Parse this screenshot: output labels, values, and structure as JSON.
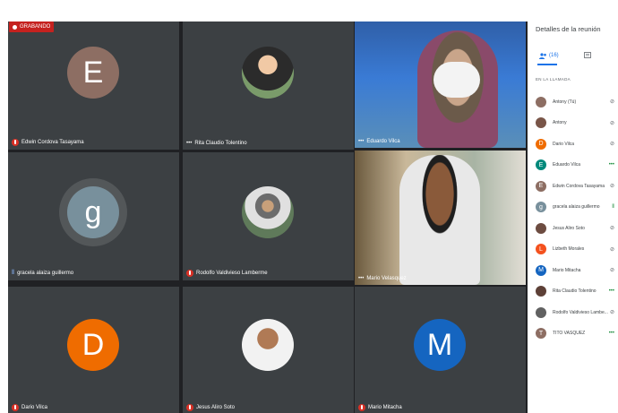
{
  "recording": {
    "label": "GRABANDO"
  },
  "tiles": [
    {
      "name": "Edwin Cordova Tasayama",
      "initial": "E",
      "color": "#8d6e63",
      "mic": "off"
    },
    {
      "name": "Rita Claudio Tolentino",
      "mic": "dots"
    },
    {
      "name": "Eduardo Vilca",
      "mic": "dots"
    },
    {
      "name": "gracela alaiza guillermo",
      "initial": "g",
      "color": "#78909c",
      "mic": "on"
    },
    {
      "name": "Rodolfo Valdivieso Lamberme",
      "mic": "off"
    },
    {
      "name": "Mario Velasquez",
      "mic": "dots"
    },
    {
      "name": "Dario Vilca",
      "initial": "D",
      "color": "#ef6c00",
      "mic": "off"
    },
    {
      "name": "Jesus Aliro Soto",
      "mic": "off"
    },
    {
      "name": "Mario Mitacha",
      "initial": "M",
      "color": "#1565c0",
      "mic": "off"
    }
  ],
  "panel": {
    "title": "Detalles de la reunión",
    "tab_people_label": "(16)",
    "section_label": "EN LA LLAMADA",
    "participants": [
      {
        "name": "Antony (Tú)",
        "initial": "",
        "color": "#8d6e63",
        "mic": "off"
      },
      {
        "name": "Antony",
        "initial": "",
        "color": "#795548",
        "mic": "off"
      },
      {
        "name": "Dario Vilca",
        "initial": "D",
        "color": "#ef6c00",
        "mic": "off"
      },
      {
        "name": "Eduardo Vilca",
        "initial": "E",
        "color": "#00897b",
        "mic": "dots"
      },
      {
        "name": "Edwin Cordova Tasayama",
        "initial": "E",
        "color": "#8d6e63",
        "mic": "off"
      },
      {
        "name": "gracela alaiza guillermo",
        "initial": "g",
        "color": "#78909c",
        "mic": "on"
      },
      {
        "name": "Jesus Aliro Soto",
        "initial": "",
        "color": "#6d4c41",
        "mic": "off"
      },
      {
        "name": "Lizbeth Morales",
        "initial": "L",
        "color": "#f4511e",
        "mic": "off"
      },
      {
        "name": "Mario Mitacha",
        "initial": "M",
        "color": "#1565c0",
        "mic": "off"
      },
      {
        "name": "Rita Claudio Tolentino",
        "initial": "",
        "color": "#5d4037",
        "mic": "dots"
      },
      {
        "name": "Rodolfo Valdivieso Lambe...",
        "initial": "",
        "color": "#616161",
        "mic": "off"
      },
      {
        "name": "TITO VASQUEZ",
        "initial": "T",
        "color": "#8d6e63",
        "mic": "dots"
      }
    ]
  }
}
